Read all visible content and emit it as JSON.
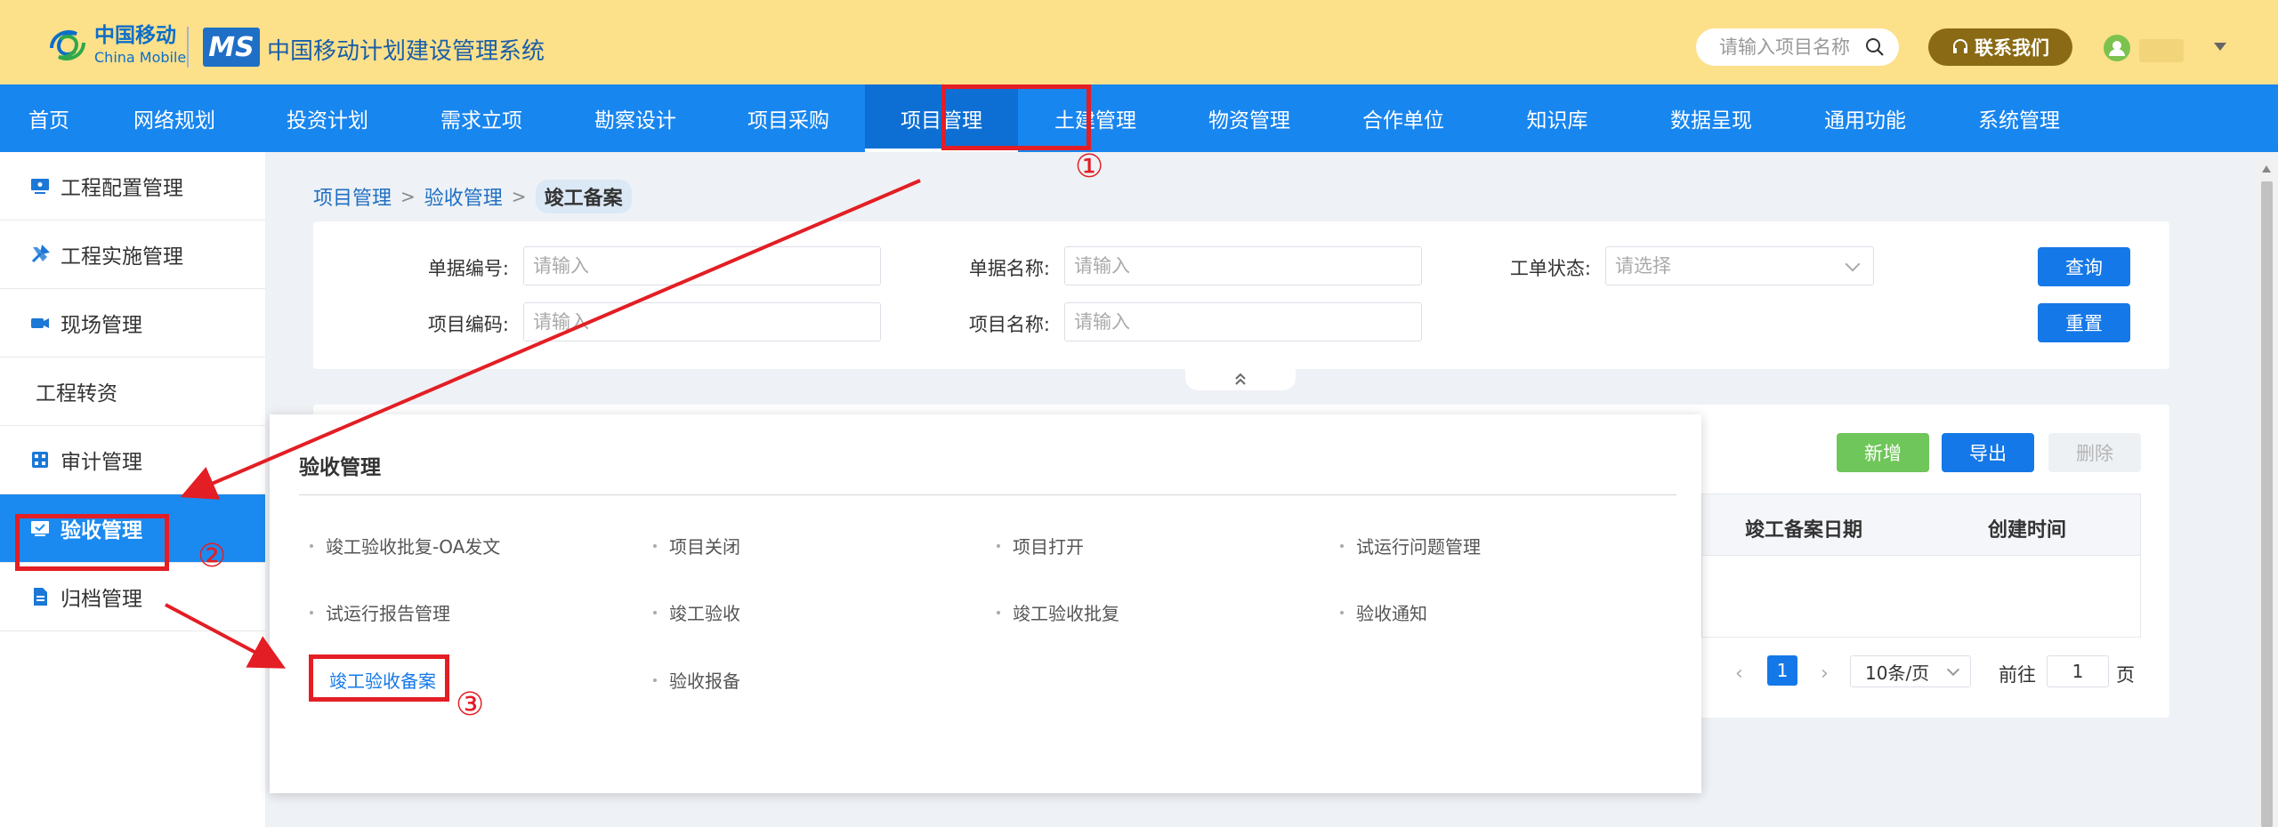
{
  "header": {
    "brand_cn": "中国移动",
    "brand_en": "China Mobile",
    "ms_logo": "MS",
    "system_title": "中国移动计划建设管理系统",
    "search_placeholder": "请输入项目名称",
    "contact_label": "联系我们",
    "brand_color": "#fde08a"
  },
  "nav": {
    "active_color": "#0d6fd4",
    "items": [
      {
        "label": "首页"
      },
      {
        "label": "网络规划"
      },
      {
        "label": "投资计划"
      },
      {
        "label": "需求立项"
      },
      {
        "label": "勘察设计"
      },
      {
        "label": "项目采购"
      },
      {
        "label": "项目管理",
        "active": true
      },
      {
        "label": "土建管理"
      },
      {
        "label": "物资管理"
      },
      {
        "label": "合作单位"
      },
      {
        "label": "知识库"
      },
      {
        "label": "数据呈现"
      },
      {
        "label": "通用功能"
      },
      {
        "label": "系统管理"
      }
    ]
  },
  "sidebar": {
    "items": [
      {
        "label": "工程配置管理",
        "icon": "monitor-icon"
      },
      {
        "label": "工程实施管理",
        "icon": "tools-icon"
      },
      {
        "label": "现场管理",
        "icon": "camera-icon"
      },
      {
        "label": "工程转资",
        "icon": ""
      },
      {
        "label": "审计管理",
        "icon": "calculator-icon"
      },
      {
        "label": "验收管理",
        "icon": "screen-check-icon",
        "active": true
      },
      {
        "label": "归档管理",
        "icon": "document-icon"
      }
    ]
  },
  "breadcrumb": {
    "level1": "项目管理",
    "level2": "验收管理",
    "current": "竣工备案"
  },
  "filters": {
    "doc_no_label": "单据编号:",
    "doc_no_placeholder": "请输入",
    "doc_name_label": "单据名称:",
    "doc_name_placeholder": "请输入",
    "status_label": "工单状态:",
    "status_placeholder": "请选择",
    "project_code_label": "项目编码:",
    "project_code_placeholder": "请输入",
    "project_name_label": "项目名称:",
    "project_name_placeholder": "请输入",
    "query_label": "查询",
    "reset_label": "重置"
  },
  "toolbar": {
    "add_label": "新增",
    "export_label": "导出",
    "delete_label": "删除"
  },
  "table": {
    "columns": [
      "竣工备案日期",
      "创建时间"
    ]
  },
  "pagination": {
    "current_page": "1",
    "page_size": "10条/页",
    "goto_prefix": "前往",
    "goto_value": "1",
    "goto_suffix": "页"
  },
  "dropdown": {
    "title": "验收管理",
    "items": [
      {
        "label": "竣工验收批复-OA发文"
      },
      {
        "label": "项目关闭"
      },
      {
        "label": "项目打开"
      },
      {
        "label": "试运行问题管理"
      },
      {
        "label": "试运行报告管理"
      },
      {
        "label": "竣工验收"
      },
      {
        "label": "竣工验收批复"
      },
      {
        "label": "验收通知"
      },
      {
        "label": "竣工验收备案",
        "selected": true
      },
      {
        "label": "验收报备"
      }
    ]
  },
  "annotations": {
    "step1": "①",
    "step2": "②",
    "step3": "③",
    "color": "#e31e24"
  }
}
